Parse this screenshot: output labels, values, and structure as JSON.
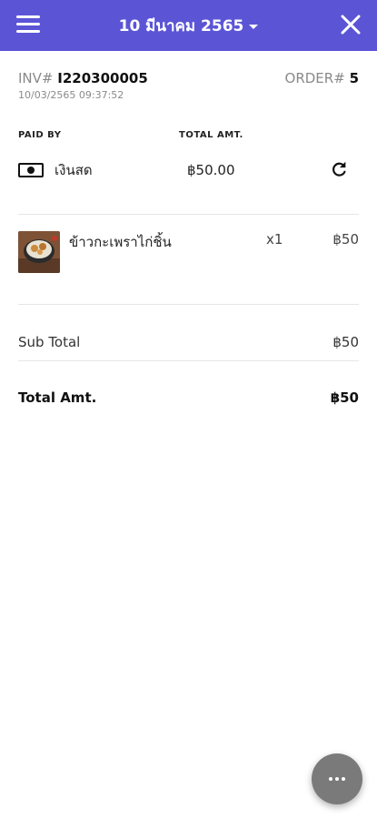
{
  "header": {
    "title": "10 มีนาคม 2565",
    "menu_icon": "hamburger-menu-icon",
    "close_icon": "close-icon",
    "bar_color": "#5b55d6"
  },
  "invoice": {
    "inv_label": "INV#",
    "inv_number": "I220300005",
    "order_label": "ORDER#",
    "order_number": "5",
    "datetime": "10/03/2565 09:37:52"
  },
  "payment": {
    "paid_by_header": "PAID BY",
    "total_amt_header": "TOTAL AMT.",
    "method": "เงินสด",
    "method_icon": "cash-icon",
    "amount": "฿50.00",
    "refresh_icon": "refresh-icon"
  },
  "items": [
    {
      "name": "ข้าวกะเพราไก่ชิ้น",
      "qty": "x1",
      "price": "฿50"
    }
  ],
  "summary": {
    "subtotal_label": "Sub Total",
    "subtotal_value": "฿50",
    "total_label": "Total Amt.",
    "total_value": "฿50"
  },
  "fab": {
    "icon": "more-options-icon"
  }
}
